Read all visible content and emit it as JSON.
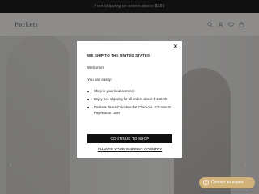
{
  "announcement": "Free shipping on orders above $150",
  "header": {
    "logo": "Pockets"
  },
  "hero": {
    "prev_arrow": "‹",
    "next_arrow": "›"
  },
  "modal": {
    "close_label": "×",
    "title": "WE SHIP TO THE UNITED STATES",
    "welcome": "Welcome!",
    "intro": "You can easily:",
    "items": [
      "Shop in your local currency",
      "Enjoy free shipping for all orders above $ 150.00",
      "Duties & Taxes Calculated at Checkout - Choose to Pay Now or Later"
    ],
    "primary_button": "CONTINUE TO SHOP",
    "secondary_link": "CHANGE YOUR SHIPPING COUNTRY"
  },
  "chat": {
    "label": "Contact an expert"
  },
  "colors": {
    "overlay": "rgba(0,0,0,0.42)",
    "button": "#111111",
    "chat": "#d1b37a"
  }
}
